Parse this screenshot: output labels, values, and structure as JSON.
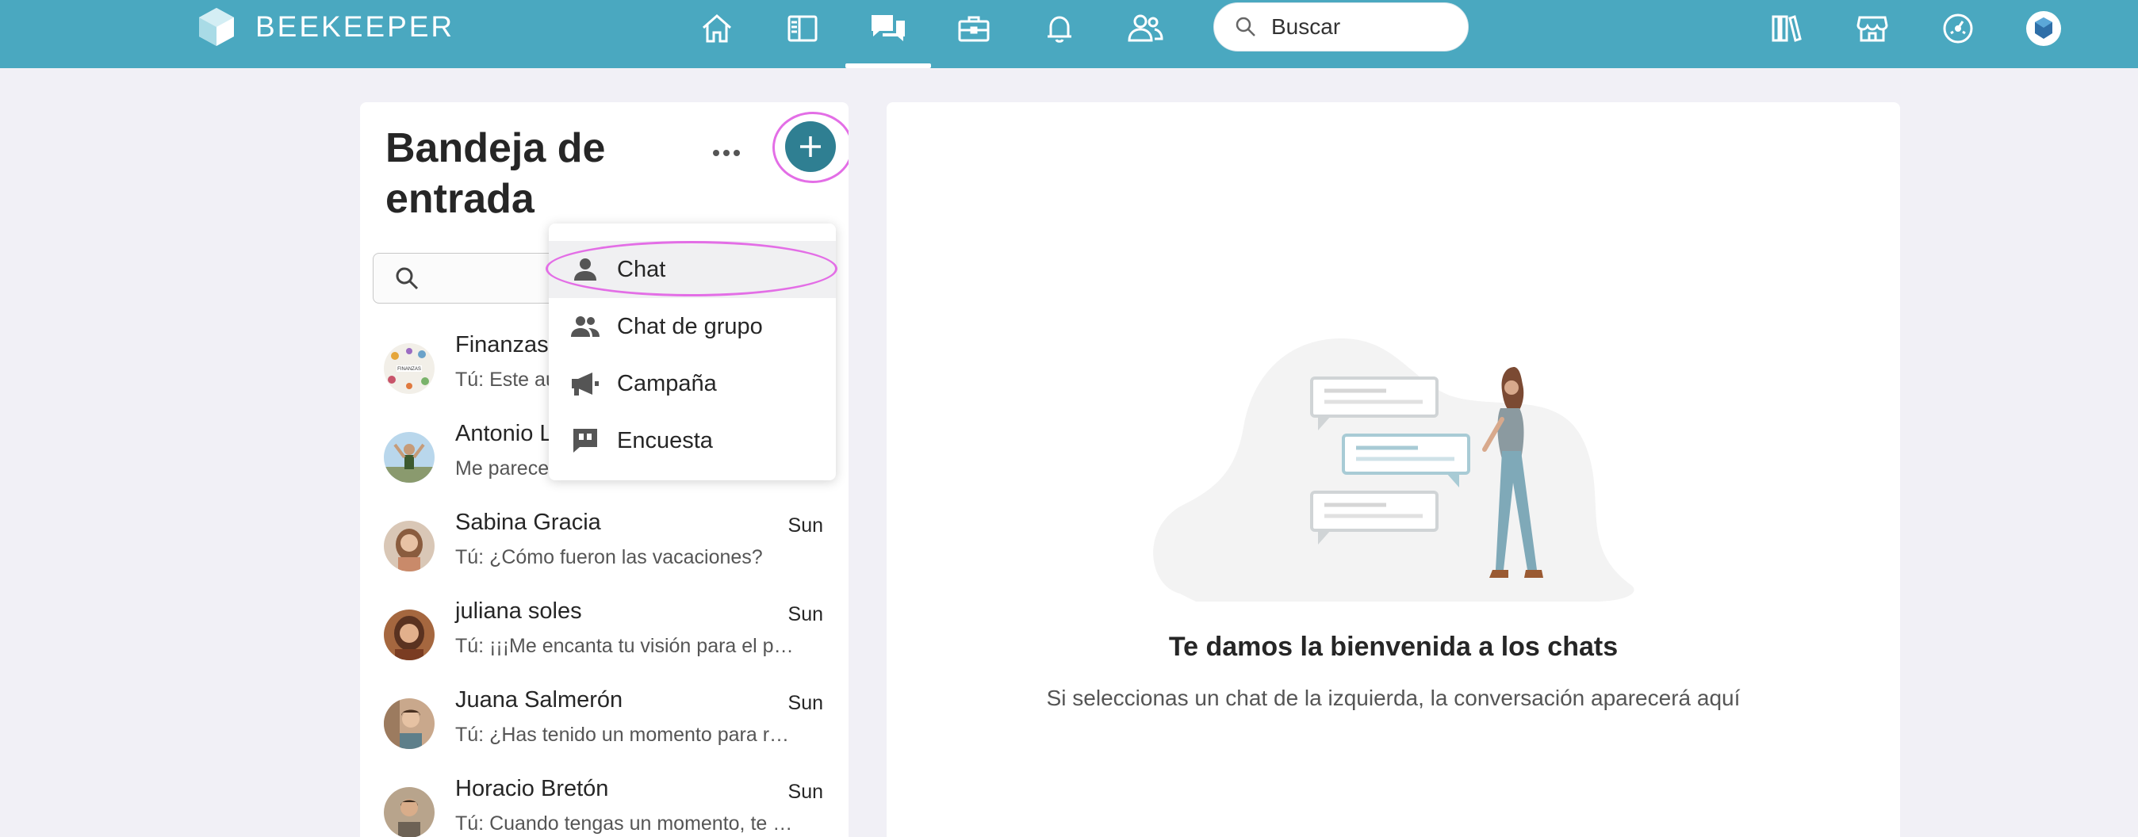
{
  "app": {
    "brand_name": "BEEKEEPER",
    "brand_color": "#4aa8c0",
    "accent_color": "#2f7f92",
    "highlight_color": "#e36ee6"
  },
  "topnav": {
    "icons": [
      "home-icon",
      "news-feed-icon",
      "chats-icon",
      "tools-icon",
      "notifications-icon",
      "people-icon"
    ],
    "active": "chats-icon",
    "search_placeholder": "Buscar",
    "right_icons": [
      "library-icon",
      "marketplace-icon",
      "dashboard-icon",
      "profile-avatar"
    ]
  },
  "inbox": {
    "title": "Bandeja de entrada",
    "more_icon": "more-horizontal-icon",
    "add_icon": "plus-icon",
    "search_icon": "search-icon"
  },
  "new_menu": {
    "items": [
      {
        "label": "Chat",
        "icon": "person-icon"
      },
      {
        "label": "Chat de grupo",
        "icon": "group-icon"
      },
      {
        "label": "Campaña",
        "icon": "megaphone-icon"
      },
      {
        "label": "Encuesta",
        "icon": "survey-icon"
      }
    ]
  },
  "chats": [
    {
      "name": "Finanzas",
      "time": "",
      "preview": "Tú: Este au"
    },
    {
      "name": "Antonio L",
      "time": "",
      "preview": "Me parece q"
    },
    {
      "name": "Sabina Gracia",
      "time": "Sun",
      "preview": "Tú: ¿Cómo fueron las vacaciones?"
    },
    {
      "name": "juliana soles",
      "time": "Sun",
      "preview": "Tú: ¡¡¡Me encanta tu visión para el proyecto!!!"
    },
    {
      "name": "Juana Salmerón",
      "time": "Sun",
      "preview": "Tú: ¿Has tenido un momento para revisar el documento?"
    },
    {
      "name": "Horacio Bretón",
      "time": "Sun",
      "preview": "Tú: Cuando tengas un momento, te escribo"
    }
  ],
  "welcome": {
    "title": "Te damos la bienvenida a los chats",
    "subtitle": "Si seleccionas un chat de la izquierda, la conversación aparecerá aquí"
  }
}
